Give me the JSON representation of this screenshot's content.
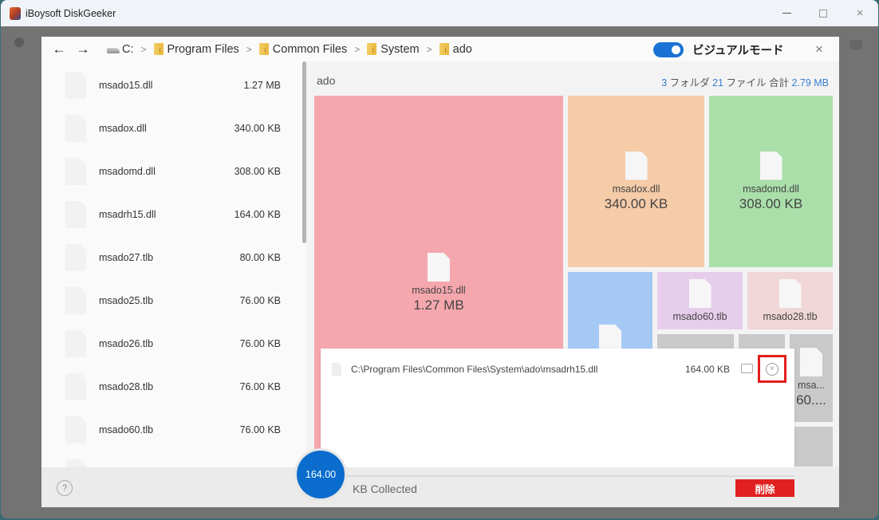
{
  "window": {
    "title": "iBoysoft DiskGeeker",
    "controls": {
      "minimize": "minimize",
      "maximize": "maximize",
      "close": "×"
    }
  },
  "nav": {
    "back_icon": "←",
    "forward_icon": "→",
    "breadcrumb": [
      {
        "label": "C:",
        "icon": "drive-icon"
      },
      {
        "label": "Program Files",
        "icon": "folder-icon"
      },
      {
        "label": "Common Files",
        "icon": "folder-icon"
      },
      {
        "label": "System",
        "icon": "folder-icon"
      },
      {
        "label": "ado",
        "icon": "folder-icon"
      }
    ],
    "separator": ">",
    "visual_mode_label": "ビジュアルモード",
    "visual_mode_on": true,
    "close_icon": "×"
  },
  "file_list": {
    "items": [
      {
        "name": "msado15.dll",
        "size": "1.27 MB"
      },
      {
        "name": "msadox.dll",
        "size": "340.00 KB"
      },
      {
        "name": "msadomd.dll",
        "size": "308.00 KB"
      },
      {
        "name": "msadrh15.dll",
        "size": "164.00 KB"
      },
      {
        "name": "msado27.tlb",
        "size": "80.00 KB"
      },
      {
        "name": "msado25.tlb",
        "size": "76.00 KB"
      },
      {
        "name": "msado26.tlb",
        "size": "76.00 KB"
      },
      {
        "name": "msado28.tlb",
        "size": "76.00 KB"
      },
      {
        "name": "msado60.tlb",
        "size": "76.00 KB"
      }
    ]
  },
  "visual": {
    "folder_name": "ado",
    "summary": {
      "folders_count": "3",
      "folders_label": " フォルダ ",
      "files_count": "21",
      "files_label": " ファイル  合計 ",
      "total": "2.79 MB"
    },
    "tiles": [
      {
        "name": "msado15.dll",
        "size": "1.27 MB",
        "color": "#f5a7ae"
      },
      {
        "name": "msadox.dll",
        "size": "340.00 KB",
        "color": "#f5cba8"
      },
      {
        "name": "msadomd.dll",
        "size": "308.00 KB",
        "color": "#aadfaa"
      },
      {
        "name": "msadrh15.dll",
        "size": "",
        "color": "#a6c8f5"
      },
      {
        "name": "msado60.tlb",
        "size": "",
        "color": "#e6cdec"
      },
      {
        "name": "msado28.tlb",
        "size": "",
        "color": "#f0d6d6"
      },
      {
        "name": "msa...",
        "size": "60....",
        "color": "#c9c9c9"
      }
    ]
  },
  "popup": {
    "path": "C:\\Program Files\\Common Files\\System\\ado\\msadrh15.dll",
    "size": "164.00 KB",
    "open_folder_icon": "folder-open-icon",
    "remove_icon": "×"
  },
  "footer": {
    "help_icon": "?",
    "collected_value": "164.00",
    "collected_label": "KB Collected",
    "delete_label": "削除"
  }
}
